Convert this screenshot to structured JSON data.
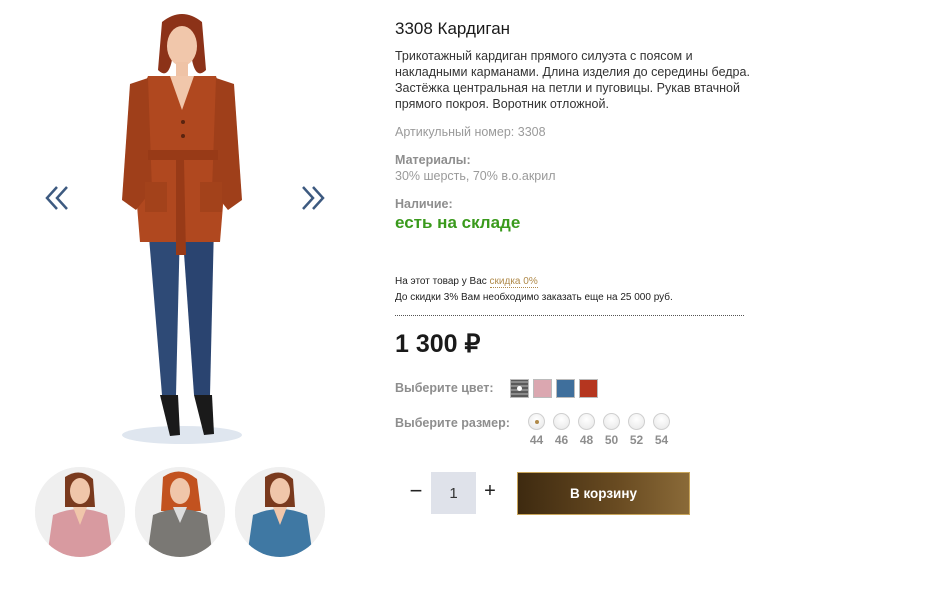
{
  "gallery": {
    "prev_icon": "double-chevron-left-icon",
    "next_icon": "double-chevron-right-icon",
    "thumbnails": [
      {
        "color": "#d89aa0"
      },
      {
        "color": "#7a7874"
      },
      {
        "color": "#3f78a3"
      }
    ]
  },
  "product": {
    "title": "3308 Кардиган",
    "description": "Трикотажный кардиган прямого силуэта с поясом и накладными карманами. Длина изделия до середины бедра. Застёжка центральная на петли и пуговицы. Рукав втачной прямого покроя. Воротник отложной.",
    "article": "Артикульный номер: 3308",
    "materials_label": "Материалы:",
    "materials_value": "30% шерсть, 70% в.о.акрил",
    "availability_label": "Наличие:",
    "availability_value": "есть на складе",
    "availability_color": "#3a9a1c"
  },
  "discount": {
    "line1_prefix": "На этот товар у Вас ",
    "line1_link": "скидка 0%",
    "line2": "До скидки 3% Вам необходимо заказать еще на 25 000 руб."
  },
  "price": "1 300 ₽",
  "color_picker": {
    "label": "Выберите цвет:",
    "options": [
      {
        "name": "grey-melange",
        "color": "#6d6d6d"
      },
      {
        "name": "pink",
        "color": "#dba7b0"
      },
      {
        "name": "blue",
        "color": "#3f6f9c"
      },
      {
        "name": "terracotta",
        "color": "#b5361f"
      }
    ]
  },
  "size_picker": {
    "label": "Выберите размер:",
    "options": [
      "44",
      "46",
      "48",
      "50",
      "52",
      "54"
    ],
    "selected": "44"
  },
  "cart": {
    "minus": "−",
    "quantity": "1",
    "plus": "+",
    "button_label": "В корзину"
  },
  "colors": {
    "accent_gold": "#b08a4a",
    "button_brown": "#4a3316"
  }
}
